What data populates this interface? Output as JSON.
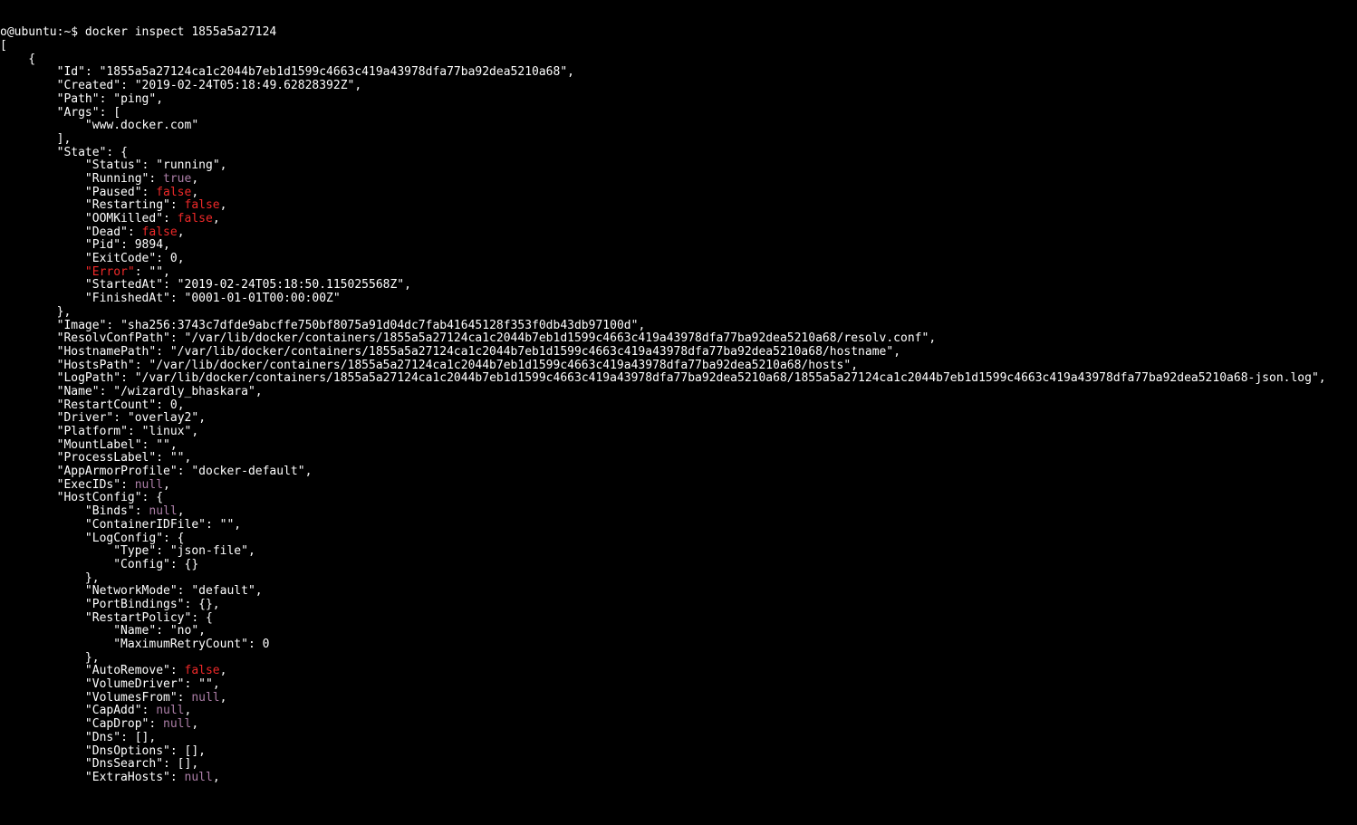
{
  "prompt": {
    "user": "o@ubuntu",
    "sep": ":",
    "path": "~",
    "dollar": "$",
    "command": "docker inspect 1855a5a27124"
  },
  "inspect": {
    "Id": "1855a5a27124ca1c2044b7eb1d1599c4663c419a43978dfa77ba92dea5210a68",
    "Created": "2019-02-24T05:18:49.62828392Z",
    "Path": "ping",
    "Args": [
      "www.docker.com"
    ],
    "State": {
      "Status": "running",
      "Running": "true",
      "Paused": "false",
      "Restarting": "false",
      "OOMKilled": "false",
      "Dead": "false",
      "Pid": "9894",
      "ExitCode": "0",
      "Error": "",
      "StartedAt": "2019-02-24T05:18:50.115025568Z",
      "FinishedAt": "0001-01-01T00:00:00Z"
    },
    "Image": "sha256:3743c7dfde9abcffe750bf8075a91d04dc7fab41645128f353f0db43db97100d",
    "ResolvConfPath": "/var/lib/docker/containers/1855a5a27124ca1c2044b7eb1d1599c4663c419a43978dfa77ba92dea5210a68/resolv.conf",
    "HostnamePath": "/var/lib/docker/containers/1855a5a27124ca1c2044b7eb1d1599c4663c419a43978dfa77ba92dea5210a68/hostname",
    "HostsPath": "/var/lib/docker/containers/1855a5a27124ca1c2044b7eb1d1599c4663c419a43978dfa77ba92dea5210a68/hosts",
    "LogPath": "/var/lib/docker/containers/1855a5a27124ca1c2044b7eb1d1599c4663c419a43978dfa77ba92dea5210a68/1855a5a27124ca1c2044b7eb1d1599c4663c419a43978dfa77ba92dea5210a68-json.log",
    "Name": "/wizardly_bhaskara",
    "RestartCount": "0",
    "Driver": "overlay2",
    "Platform": "linux",
    "MountLabel": "",
    "ProcessLabel": "",
    "AppArmorProfile": "docker-default",
    "ExecIDs": "null",
    "HostConfig": {
      "Binds": "null",
      "ContainerIDFile": "",
      "LogConfig": {
        "Type": "json-file",
        "Config": "{}"
      },
      "NetworkMode": "default",
      "PortBindings": "{}",
      "RestartPolicy": {
        "Name": "no",
        "MaximumRetryCount": "0"
      },
      "AutoRemove": "false",
      "VolumeDriver": "",
      "VolumesFrom": "null",
      "CapAdd": "null",
      "CapDrop": "null",
      "Dns": "[]",
      "DnsOptions": "[]",
      "DnsSearch": "[]",
      "ExtraHosts": "null"
    }
  }
}
